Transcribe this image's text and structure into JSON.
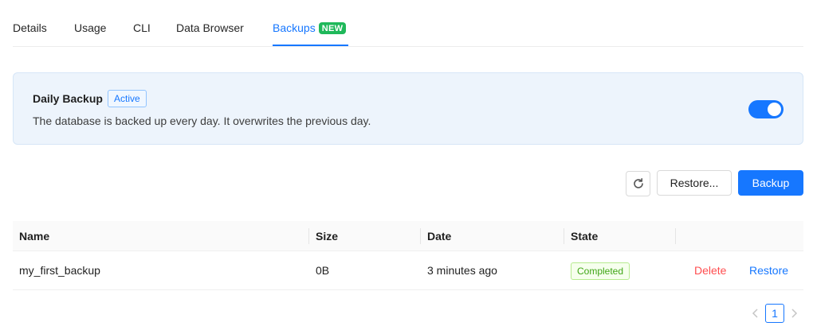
{
  "tabs": [
    {
      "label": "Details"
    },
    {
      "label": "Usage"
    },
    {
      "label": "CLI"
    },
    {
      "label": "Data Browser"
    },
    {
      "label": "Backups",
      "badge": "NEW",
      "active": true
    }
  ],
  "backup_card": {
    "title": "Daily Backup",
    "status": "Active",
    "description": "The database is backed up every day. It overwrites the previous day.",
    "toggle_on": true
  },
  "toolbar": {
    "refresh_icon": "refresh-icon",
    "restore_label": "Restore...",
    "backup_label": "Backup"
  },
  "table": {
    "columns": [
      "Name",
      "Size",
      "Date",
      "State"
    ],
    "rows": [
      {
        "name": "my_first_backup",
        "size": "0B",
        "date": "3 minutes ago",
        "state": "Completed",
        "actions": {
          "delete": "Delete",
          "restore": "Restore"
        }
      }
    ]
  },
  "pagination": {
    "current_page": "1",
    "prev_icon": "chevron-left-icon",
    "next_icon": "chevron-right-icon"
  },
  "colors": {
    "accent": "#1677ff",
    "success": "#52c41a",
    "danger": "#ff4d4f",
    "new_badge": "#1fb85a",
    "card_bg": "#edf4fc"
  }
}
